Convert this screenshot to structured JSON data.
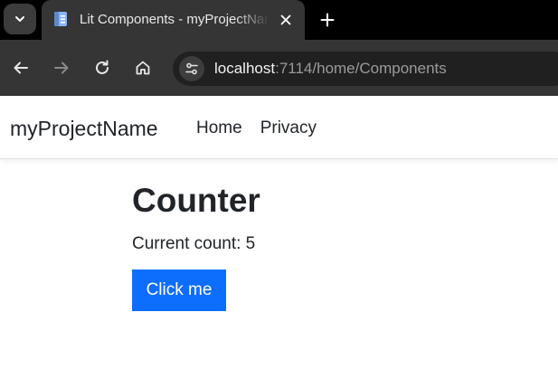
{
  "browser": {
    "tab": {
      "title": "Lit Components - myProjectName"
    },
    "address_bar": {
      "host": "localhost",
      "path": ":7114/home/Components"
    },
    "colors": {
      "tabstrip": "#000000",
      "toolbar": "#353535",
      "omnibox": "#202020"
    },
    "icons": {
      "tab_menu": "chevron-down-icon",
      "favicon": "page-icon",
      "close": "close-icon",
      "new_tab": "plus-icon",
      "back": "arrow-left-icon",
      "forward": "arrow-right-icon",
      "reload": "reload-icon",
      "home": "home-icon",
      "site_info": "tune-icon"
    }
  },
  "site": {
    "brand": "myProjectName",
    "nav": [
      {
        "label": "Home"
      },
      {
        "label": "Privacy"
      }
    ]
  },
  "counter": {
    "title": "Counter",
    "count_text": "Current count: 5",
    "button_label": "Click me",
    "button_color": "#0d6efd"
  }
}
